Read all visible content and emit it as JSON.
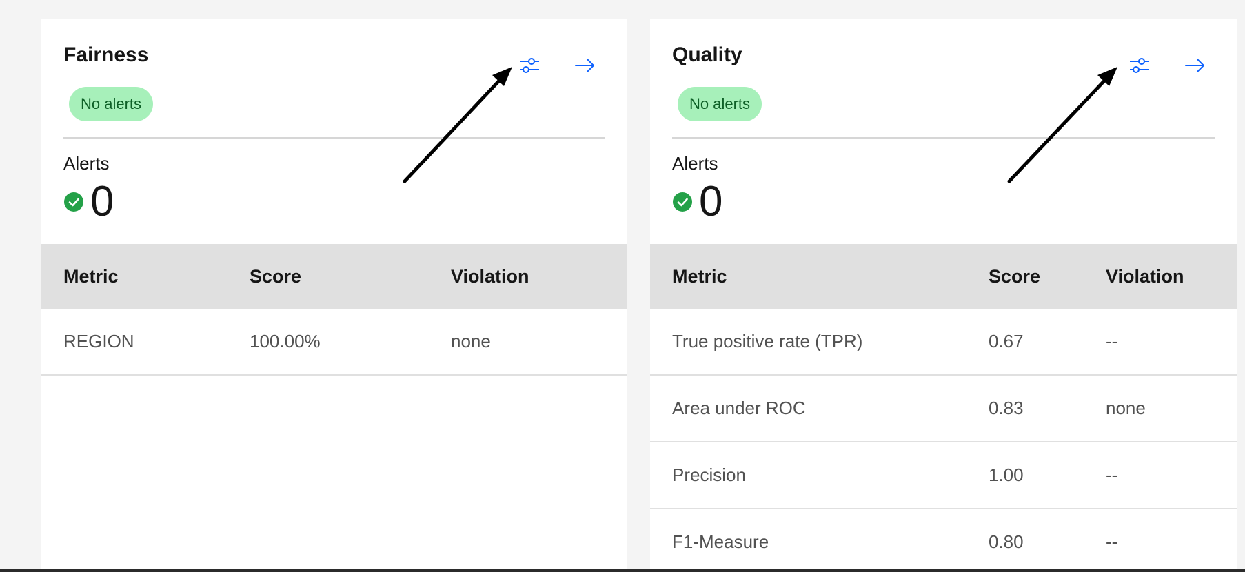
{
  "cards": [
    {
      "title": "Fairness",
      "badge": "No alerts",
      "alerts_label": "Alerts",
      "alerts_count": "0",
      "columns": [
        "Metric",
        "Score",
        "Violation"
      ],
      "rows": [
        [
          "REGION",
          "100.00%",
          "none"
        ]
      ]
    },
    {
      "title": "Quality",
      "badge": "No alerts",
      "alerts_label": "Alerts",
      "alerts_count": "0",
      "columns": [
        "Metric",
        "Score",
        "Violation"
      ],
      "rows": [
        [
          "True positive rate (TPR)",
          "0.67",
          "--"
        ],
        [
          "Area under ROC",
          "0.83",
          "none"
        ],
        [
          "Precision",
          "1.00",
          "--"
        ],
        [
          "F1-Measure",
          "0.80",
          "--"
        ]
      ]
    }
  ],
  "icons": {
    "settings": "settings-adjust-icon",
    "open": "arrow-right-icon",
    "status": "checkmark-filled-icon"
  },
  "colors": {
    "accent": "#0f62fe",
    "badge_bg": "#a7f0ba",
    "badge_text": "#0e6027",
    "success": "#24a148",
    "table_header_bg": "#e0e0e0",
    "page_bg": "#f4f4f4",
    "annotation_arrow": "#000000"
  }
}
